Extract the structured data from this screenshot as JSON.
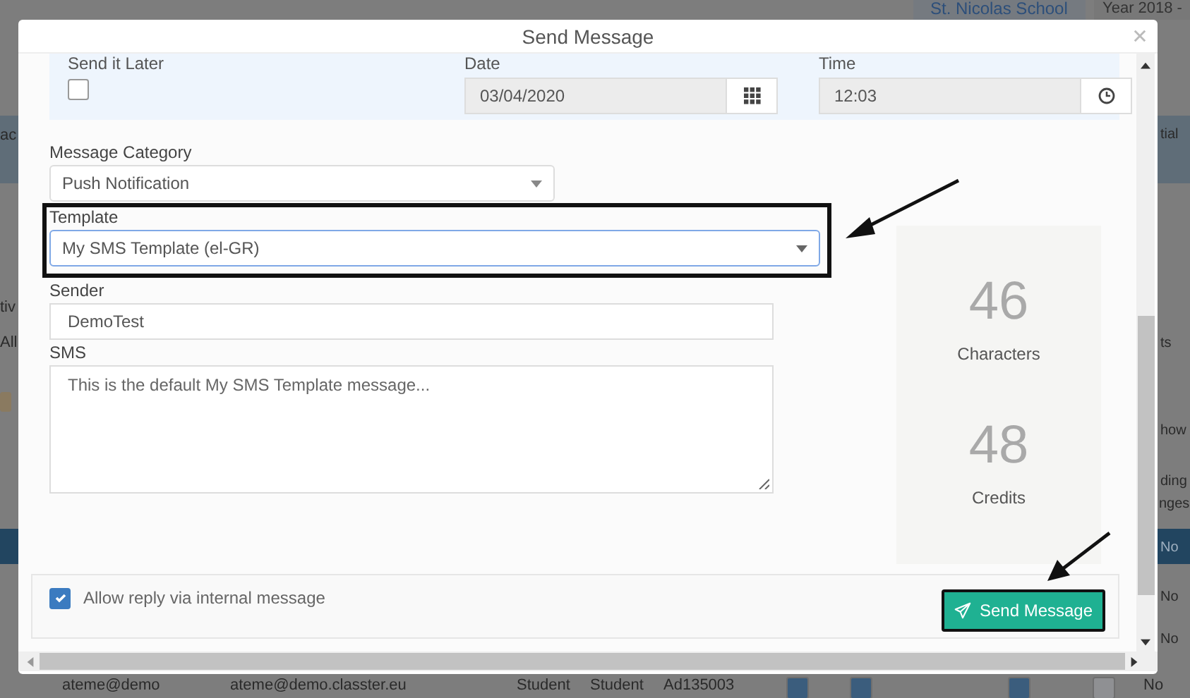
{
  "background_page": {
    "school": "St. Nicolas School",
    "year": "Year 2018 -",
    "fragments_left": [
      "ac",
      "tiv",
      "All"
    ],
    "fragments_right": [
      "tial",
      "ts",
      "how",
      "ding",
      "nges",
      "No",
      "No",
      "No"
    ],
    "bottom_row": [
      "ateme@demo",
      "ateme@demo.classter.eu",
      "Student",
      "Student",
      "Ad135003",
      "No"
    ],
    "bottom_row_checks": [
      true,
      true,
      true,
      false
    ]
  },
  "dialog": {
    "title": "Send Message",
    "schedule": {
      "send_later_label": "Send it Later",
      "send_later_checked": false,
      "date_label": "Date",
      "date_value": "03/04/2020",
      "time_label": "Time",
      "time_value": "12:03"
    },
    "fields": [
      {
        "label": "Message Category",
        "kind": "select",
        "value": "Push Notification",
        "highlighted": false
      },
      {
        "label": "Template",
        "kind": "select",
        "value": "My SMS Template (el-GR)",
        "highlighted": true
      },
      {
        "label": "Sender",
        "kind": "text",
        "value": "DemoTest",
        "highlighted": false
      },
      {
        "label": "SMS",
        "kind": "textarea",
        "value": "This is the default My SMS Template message...",
        "highlighted": false
      }
    ],
    "stats": [
      {
        "value": "46",
        "label": "Characters"
      },
      {
        "value": "48",
        "label": "Credits"
      }
    ],
    "allow_reply": {
      "label": "Allow reply via internal message",
      "checked": true
    },
    "send_button": {
      "label": "Send Message",
      "highlighted": true
    }
  }
}
